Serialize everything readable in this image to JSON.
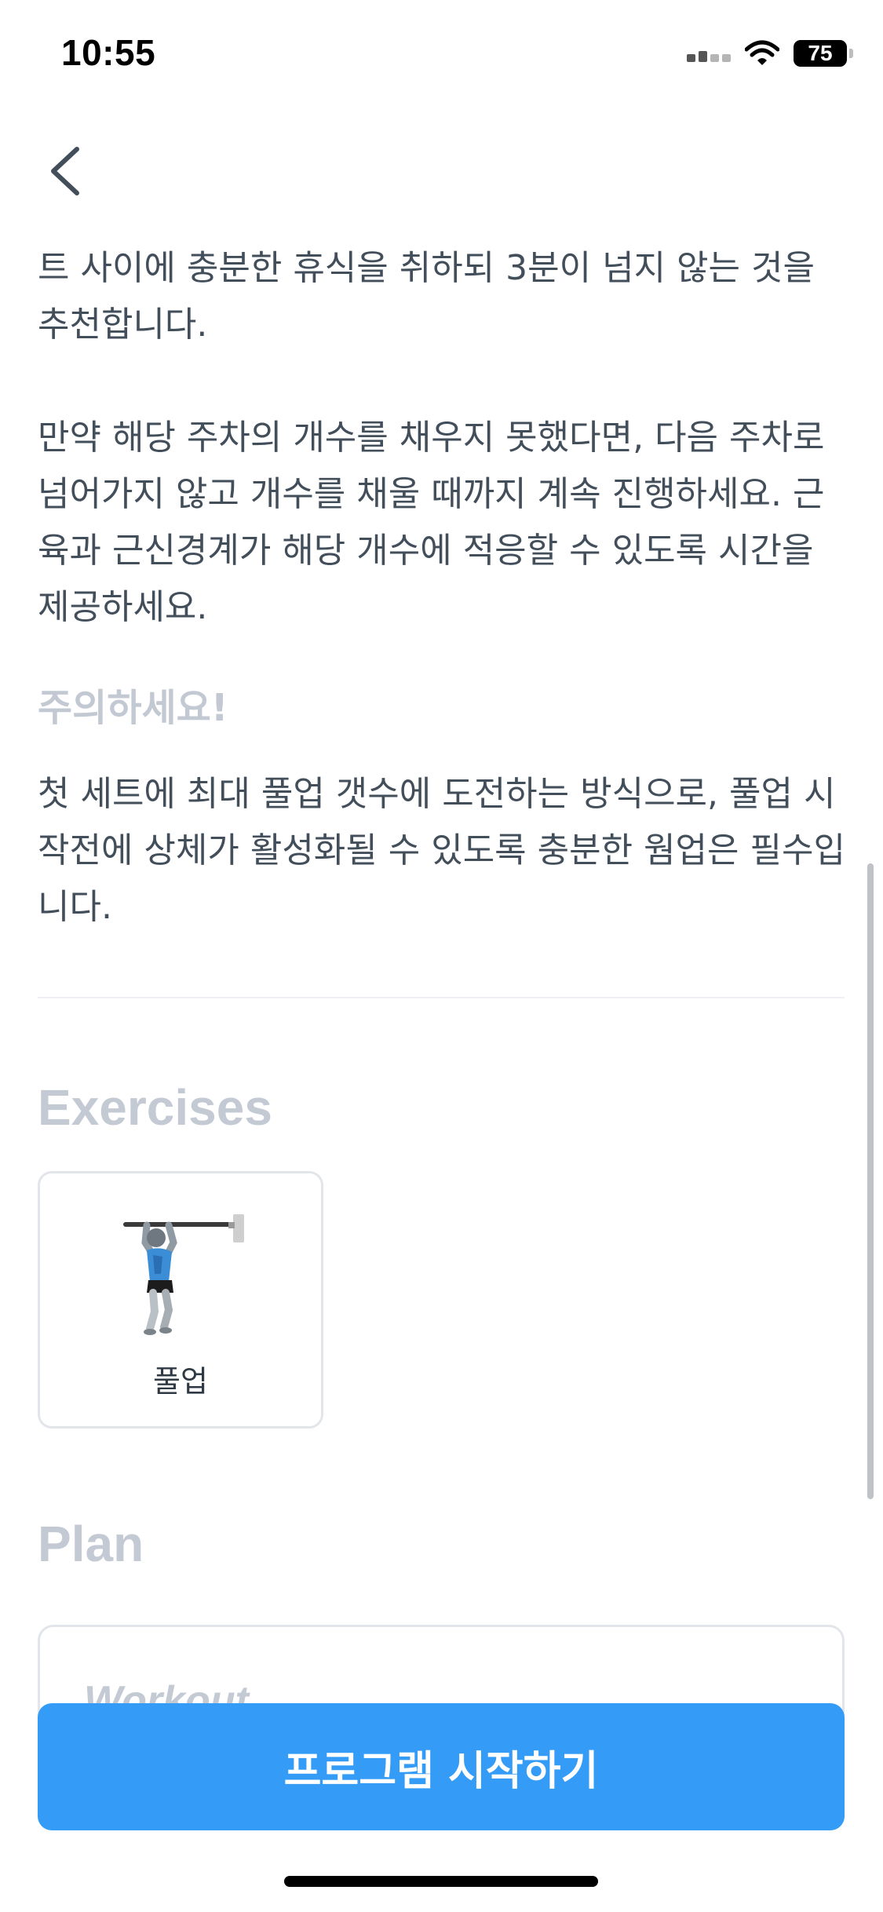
{
  "status_bar": {
    "time": "10:55",
    "battery": "75"
  },
  "content": {
    "paragraph_1": "트 사이에 충분한 휴식을 취하되 3분이 넘지 않는 것을 추천합니다.",
    "paragraph_2": "만약 해당 주차의 개수를 채우지 못했다면, 다음 주차로 넘어가지 않고 개수를 채울 때까지 계속 진행하세요. 근육과 근신경계가 해당 개수에 적응할 수 있도록 시간을 제공하세요.",
    "caution_title": "주의하세요!",
    "paragraph_3": "첫 세트에 최대 풀업 갯수에 도전하는 방식으로, 풀업 시작전에 상체가 활성화될 수 있도록 충분한 웜업은 필수입니다."
  },
  "exercises": {
    "title": "Exercises",
    "items": [
      {
        "label": "풀업",
        "icon": "pullup-figure"
      }
    ]
  },
  "plan": {
    "title": "Plan",
    "card_heading": "Workout"
  },
  "start_button": {
    "label": "프로그램 시작하기"
  },
  "colors": {
    "primary": "#349cf6",
    "body_text": "#434e5b",
    "muted_heading": "#c4cad3"
  }
}
